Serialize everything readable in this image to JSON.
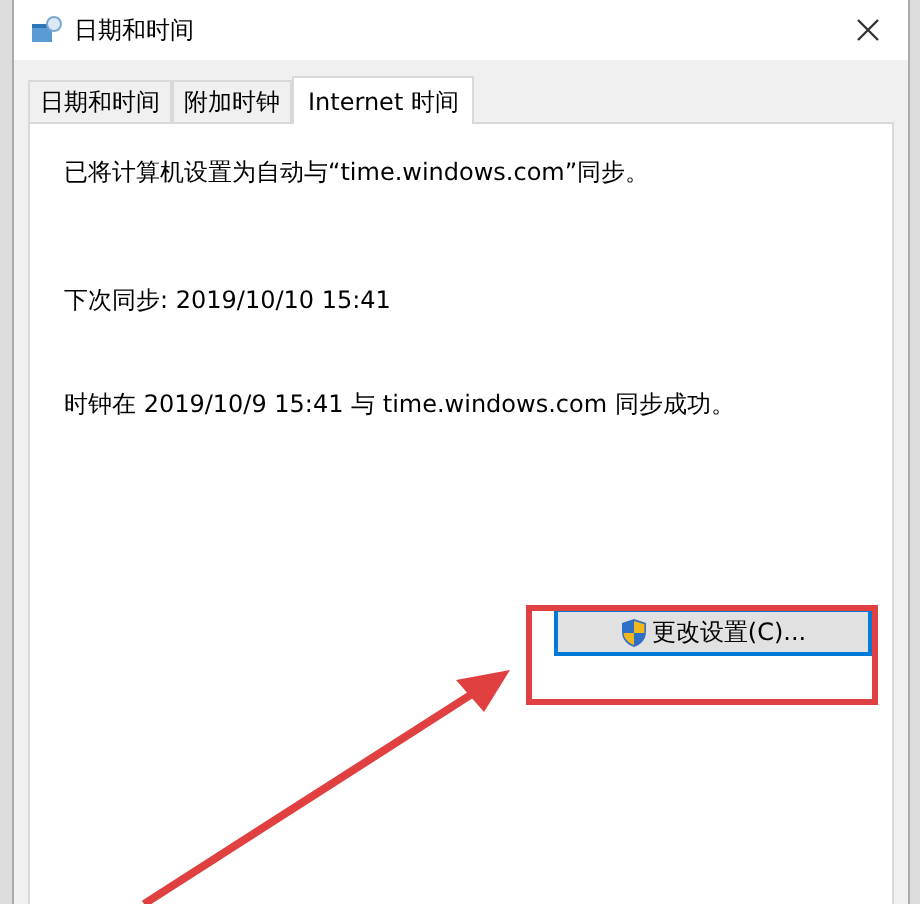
{
  "window": {
    "title": "日期和时间"
  },
  "tabs": [
    {
      "label": "日期和时间",
      "selected": false
    },
    {
      "label": "附加时钟",
      "selected": false
    },
    {
      "label": "Internet 时间",
      "selected": true
    }
  ],
  "lines": [
    "已将计算机设置为自动与“time.windows.com”同步。",
    "下次同步: 2019/10/10 15:41",
    "时钟在 2019/10/9 15:41 与 time.windows.com 同步成功。"
  ],
  "button": {
    "label": "更改设置(C)...",
    "focused": true
  }
}
